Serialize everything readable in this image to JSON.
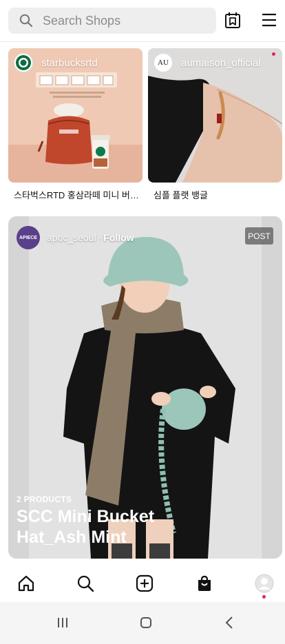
{
  "header": {
    "search_placeholder": "Search Shops",
    "icons": {
      "search": "search-icon",
      "calendar": "calendar-bookmark-icon",
      "menu": "hamburger-menu-icon"
    }
  },
  "cards": [
    {
      "username": "starbucksrtd",
      "title": "스타벅스RTD 홍삼라떼 미니 버킷...",
      "avatar": "starbucks-logo"
    },
    {
      "username": "aumaison_official",
      "title": "심플 플랫 뱅글",
      "avatar_text": "AU"
    }
  ],
  "post": {
    "username": "apoc_seoul",
    "separator": "·",
    "follow_label": "Follow",
    "avatar_text": "APIECE",
    "badge": "POST",
    "product_count": "2 PRODUCTS",
    "title": "SCC Mini Bucket Hat_Ash Mint"
  },
  "tabbar": {
    "items": [
      "home-icon",
      "search-icon",
      "add-post-icon",
      "shopping-bag-icon",
      "profile-avatar-icon"
    ],
    "notification_color": "#e0245e"
  },
  "system_nav": [
    "recent-apps-icon",
    "home-circle-icon",
    "back-icon"
  ]
}
